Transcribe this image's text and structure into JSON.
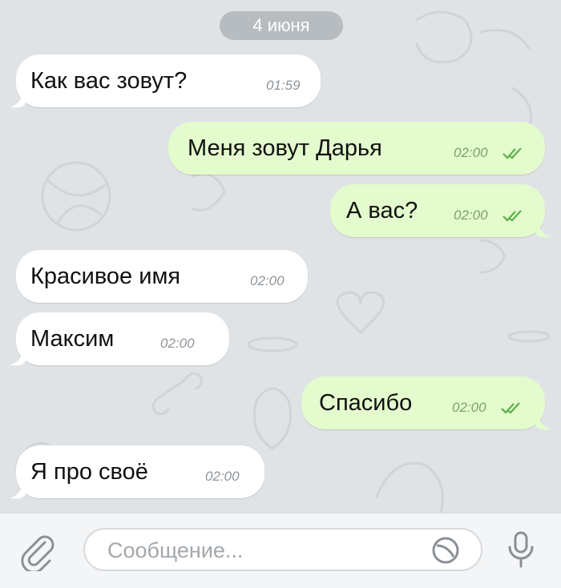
{
  "chat": {
    "date": "4 июня",
    "messages": [
      {
        "direction": "incoming",
        "text": "Как вас зовут?",
        "time": "01:59"
      },
      {
        "direction": "outgoing",
        "text": "Меня зовут Дарья",
        "time": "02:00",
        "status": "read"
      },
      {
        "direction": "outgoing",
        "text": "А вас?",
        "time": "02:00",
        "status": "read"
      },
      {
        "direction": "incoming",
        "text": "Красивое имя",
        "time": "02:00"
      },
      {
        "direction": "incoming",
        "text": "Максим",
        "time": "02:00"
      },
      {
        "direction": "outgoing",
        "text": "Спасибо",
        "time": "02:00",
        "status": "read"
      },
      {
        "direction": "incoming",
        "text": "Я про своё",
        "time": "02:00"
      }
    ]
  },
  "composer": {
    "placeholder": "Сообщение...",
    "attach_icon": "paperclip-icon",
    "sticker_icon": "sticker-icon",
    "mic_icon": "microphone-icon"
  },
  "colors": {
    "incoming_bubble": "#ffffff",
    "outgoing_bubble": "#e3fbcd",
    "read_check": "#5eb04a",
    "date_pill": "#b7bcc1"
  }
}
